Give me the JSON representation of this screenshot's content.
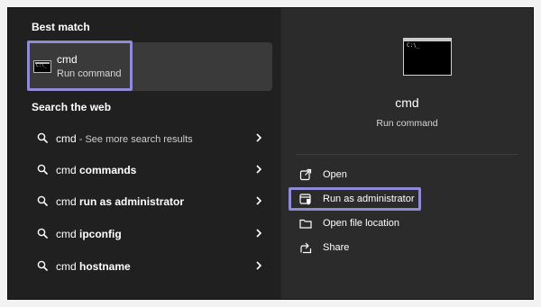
{
  "sections": {
    "best_match": "Best match",
    "search_web": "Search the web"
  },
  "best_match": {
    "title": "cmd",
    "subtitle": "Run command",
    "icon_text": "C:\\_"
  },
  "web_results": [
    {
      "prefix": "cmd",
      "suffix": " - See more search results",
      "style": "light"
    },
    {
      "prefix": "cmd",
      "suffix": " commands",
      "style": "bold"
    },
    {
      "prefix": "cmd",
      "suffix": " run as administrator",
      "style": "bold"
    },
    {
      "prefix": "cmd",
      "suffix": " ipconfig",
      "style": "bold"
    },
    {
      "prefix": "cmd",
      "suffix": " hostname",
      "style": "bold"
    }
  ],
  "details": {
    "title": "cmd",
    "subtitle": "Run command",
    "icon_text": "C:\\_"
  },
  "actions": [
    {
      "label": "Open",
      "icon": "open-icon"
    },
    {
      "label": "Run as administrator",
      "icon": "shield-admin-icon"
    },
    {
      "label": "Open file location",
      "icon": "folder-icon"
    },
    {
      "label": "Share",
      "icon": "share-icon"
    }
  ],
  "colors": {
    "highlight": "#8f8bd6",
    "panel_left": "#202020",
    "panel_right": "#2b2b2b",
    "card": "#3a3a3a"
  }
}
